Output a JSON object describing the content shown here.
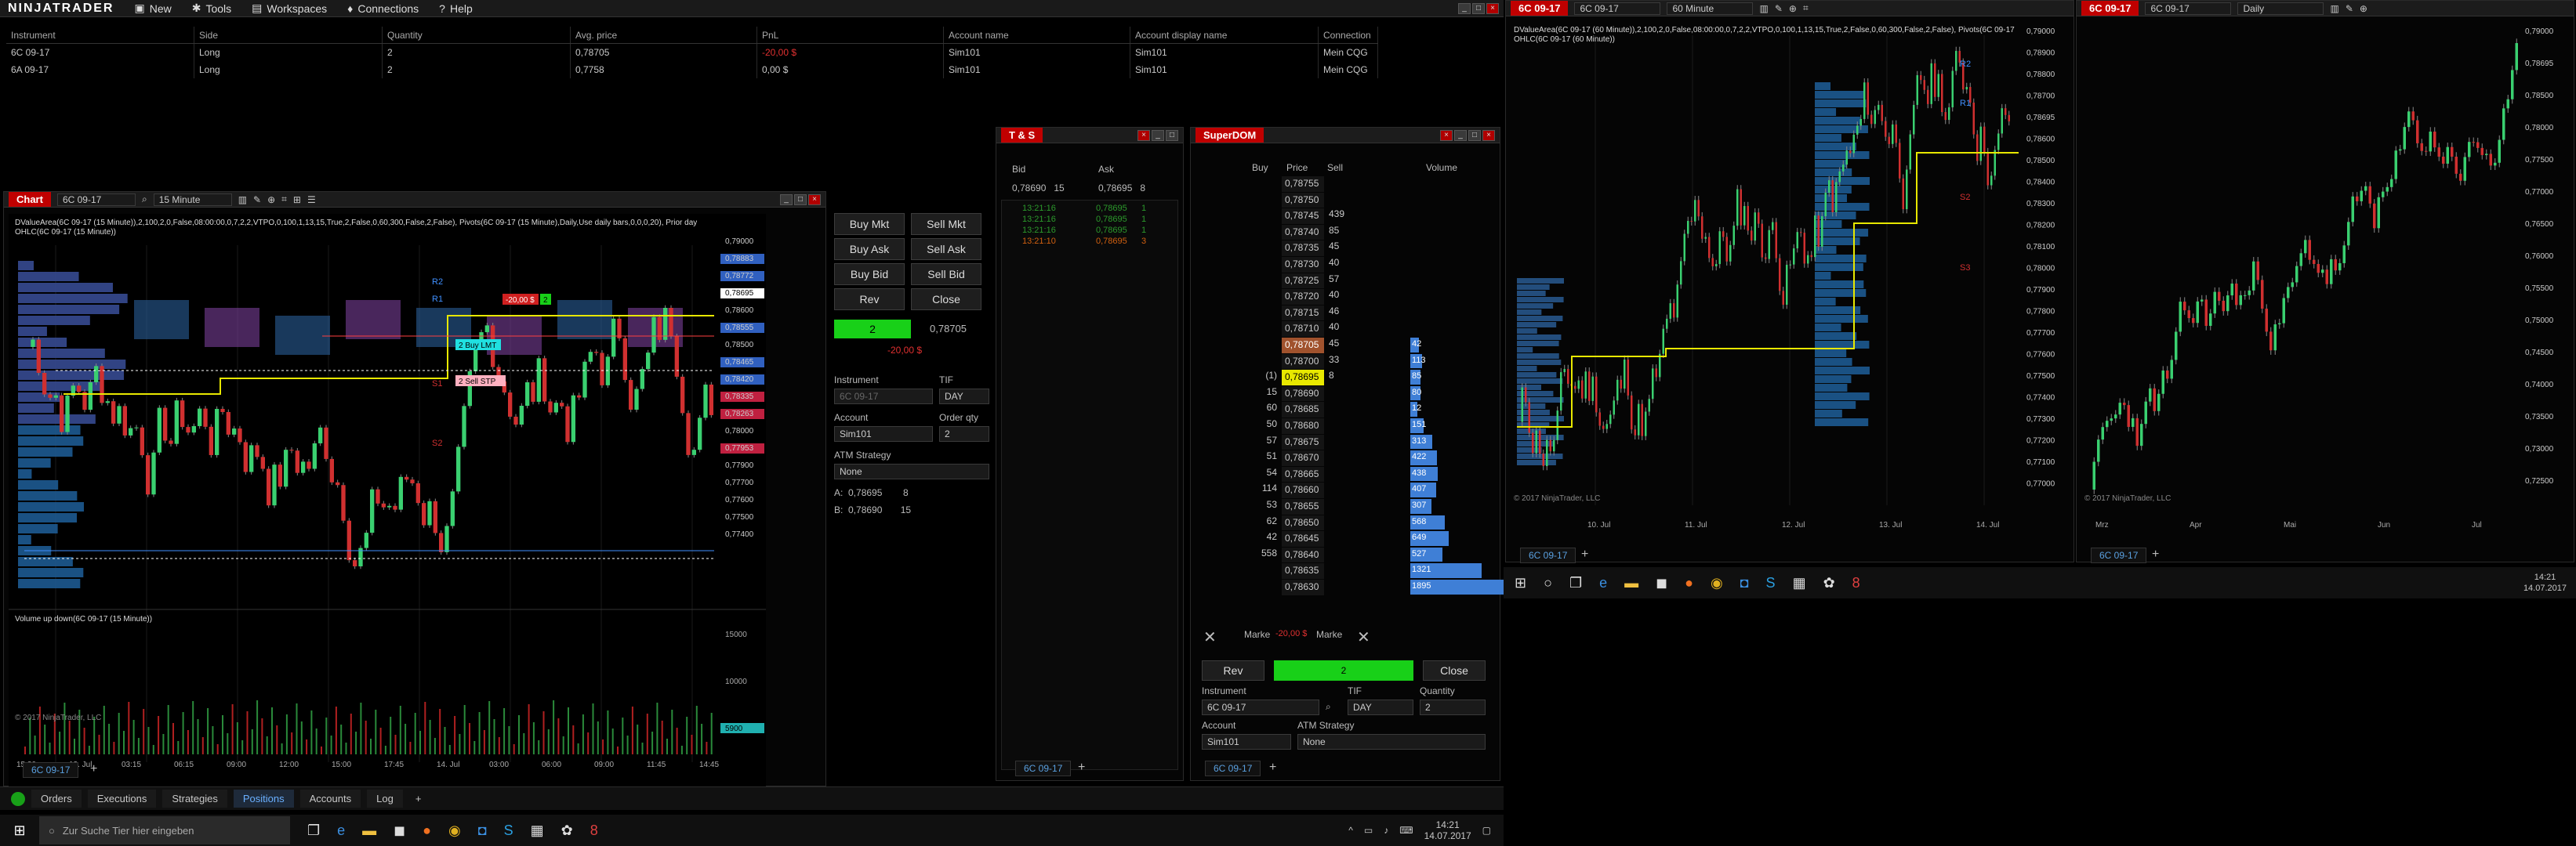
{
  "app": {
    "logo": "NINJATRADER",
    "menu": [
      "New",
      "Tools",
      "Workspaces",
      "Connections",
      "Help"
    ]
  },
  "positions": {
    "headers": [
      "Instrument",
      "Side",
      "Quantity",
      "Avg. price",
      "PnL",
      "Account name",
      "Account display name",
      "Connection"
    ],
    "rows": [
      [
        "6C 09-17",
        "Long",
        "2",
        "0,78705",
        "-20,00 $",
        "Sim101",
        "Sim101",
        "Mein CQG"
      ],
      [
        "6A 09-17",
        "Long",
        "2",
        "0,7758",
        "0,00 $",
        "Sim101",
        "Sim101",
        "Mein CQG"
      ]
    ]
  },
  "chart1": {
    "tab": "Chart",
    "instrument": "6C 09-17",
    "interval": "15 Minute",
    "indicator_line1": "DValueArea(6C 09-17 (15 Minute)),2,100,2,0,False,08:00:00,0,7,2,2,VTPO,0,100,1,13,15,True,2,False,0,60,300,False,2,False), Pivots(6C 09-17 (15 Minute),Daily,Use daily bars,0,0,0,20), Prior day",
    "indicator_line2": "OHLC(6C 09-17 (15 Minute))",
    "price_labels": [
      "0,79000",
      "0,78883",
      "0,78772",
      "0,78695",
      "0,78600",
      "0,78555",
      "0,78500",
      "0,78465",
      "0,78420",
      "0,78335",
      "0,78263",
      "0,78000",
      "0,77953",
      "0,77900",
      "0,77700",
      "0,77600",
      "0,77500",
      "0,77400"
    ],
    "time_labels": [
      "15:30",
      "13. Jul",
      "03:15",
      "06:15",
      "09:00",
      "12:00",
      "15:00",
      "17:45",
      "14. Jul",
      "03:00",
      "06:00",
      "09:00",
      "11:45",
      "14:45"
    ],
    "orders": {
      "buy_lmt": "2  Buy LMT",
      "sell_stp": "2  Sell STP",
      "pnl_flag": "-20,00 $",
      "qty_flag": "2"
    },
    "pivot_labels": [
      "R2",
      "R1",
      "S1",
      "S2"
    ],
    "volume_title": "Volume up down(6C 09-17 (15 Minute))",
    "volume_axis": [
      "15000",
      "10000",
      "5000"
    ],
    "volume_last": "5900",
    "copyright": "© 2017 NinjaTrader, LLC",
    "bottom_tab": "6C 09-17"
  },
  "chart_trader": {
    "buttons": [
      "Buy Mkt",
      "Sell Mkt",
      "Buy Ask",
      "Sell Ask",
      "Buy Bid",
      "Sell Bid",
      "Rev",
      "Close"
    ],
    "position_qty": "2",
    "avg_price": "0,78705",
    "pnl": "-20,00 $",
    "instrument_label": "Instrument",
    "instrument": "6C 09-17",
    "tif_label": "TIF",
    "tif": "DAY",
    "account_label": "Account",
    "account": "Sim101",
    "qty_label": "Order qty",
    "qty": "2",
    "atm_label": "ATM Strategy",
    "atm": "None",
    "ask_line": "A:  0,78695        8",
    "bid_line": "B:  0,78690       15"
  },
  "bottom_tabs": [
    "Orders",
    "Executions",
    "Strategies",
    "Positions",
    "Accounts",
    "Log"
  ],
  "ts": {
    "title": "T & S",
    "bid_h": "Bid",
    "ask_h": "Ask",
    "bid": "0,78690   15",
    "ask": "0,78695   8",
    "rows": [
      [
        "13:21:16",
        "0,78695",
        "1"
      ],
      [
        "13:21:16",
        "0,78695",
        "1"
      ],
      [
        "13:21:16",
        "0,78695",
        "1"
      ],
      [
        "13:21:10",
        "0,78695",
        "3"
      ]
    ],
    "tab": "6C 09-17"
  },
  "dom": {
    "title": "SuperDOM",
    "headers": [
      "Buy",
      "Price",
      "Sell",
      "Volume"
    ],
    "rows": [
      [
        "",
        "0,78755",
        ""
      ],
      [
        "",
        "0,78750",
        ""
      ],
      [
        "",
        "0,78745",
        "439"
      ],
      [
        "",
        "0,78740",
        "85"
      ],
      [
        "",
        "0,78735",
        "45"
      ],
      [
        "",
        "0,78730",
        "40"
      ],
      [
        "",
        "0,78725",
        "57"
      ],
      [
        "",
        "0,78720",
        "40"
      ],
      [
        "",
        "0,78715",
        "46"
      ],
      [
        "",
        "0,78710",
        "40"
      ],
      [
        "",
        "0,78705",
        "45"
      ],
      [
        "",
        "0,78700",
        "33"
      ],
      [
        "(1)",
        "0,78695",
        "8"
      ],
      [
        "15",
        "0,78690",
        ""
      ],
      [
        "60",
        "0,78685",
        ""
      ],
      [
        "50",
        "0,78680",
        ""
      ],
      [
        "57",
        "0,78675",
        ""
      ],
      [
        "51",
        "0,78670",
        ""
      ],
      [
        "54",
        "0,78665",
        ""
      ],
      [
        "114",
        "0,78660",
        ""
      ],
      [
        "53",
        "0,78655",
        ""
      ],
      [
        "62",
        "0,78650",
        ""
      ],
      [
        "42",
        "0,78645",
        ""
      ],
      [
        "558",
        "0,78640",
        ""
      ],
      [
        "",
        "0,78635",
        ""
      ],
      [
        "",
        "0,78630",
        ""
      ]
    ],
    "volume_values": [
      "42",
      "113",
      "85",
      "80",
      "12",
      "151",
      "313",
      "422",
      "438",
      "407",
      "307",
      "568",
      "649",
      "527",
      "1321",
      "1895"
    ],
    "market_row": "Marke",
    "pnl": "-20,00 $",
    "pos": "2",
    "rev": "Rev",
    "close": "Close",
    "instrument_label": "Instrument",
    "instrument": "6C 09-17",
    "tif_label": "TIF",
    "tif": "DAY",
    "qty_label": "Quantity",
    "qty": "2",
    "account_label": "Account",
    "account": "Sim101",
    "atm_label": "ATM Strategy",
    "atm": "None",
    "tab": "6C 09-17"
  },
  "chart2": {
    "tab": "6C 09-17",
    "instrument": "6C 09-17",
    "interval": "60 Minute",
    "indicator_line1": "DValueArea(6C 09-17 (60 Minute)),2,100,2,0,False,08:00:00,0,7,2,2,VTPO,0,100,1,13,15,True,2,False,0,60,300,False,2,False), Pivots(6C 09-17 (60 Minute),Daily,Use daily bars,0,0,0,20), Prior day",
    "indicator_line2": "OHLC(6C 09-17 (60 Minute))",
    "price_labels": [
      "0,79000",
      "0,78900",
      "0,78800",
      "0,78700",
      "0,78695",
      "0,78600",
      "0,78500",
      "0,78400",
      "0,78300",
      "0,78200",
      "0,78100",
      "0,78000",
      "0,77900",
      "0,77800",
      "0,77700",
      "0,77600",
      "0,77500",
      "0,77400",
      "0,77300",
      "0,77200",
      "0,77100",
      "0,77000"
    ],
    "time_labels": [
      "10. Jul",
      "11. Jul",
      "12. Jul",
      "13. Jul",
      "14. Jul"
    ],
    "pivot_labels": [
      "R2",
      "R1",
      "S2",
      "S3"
    ],
    "copyright": "© 2017 NinjaTrader, LLC"
  },
  "chart3": {
    "tab": "6C 09-17",
    "instrument": "6C 09-17",
    "interval": "Daily",
    "price_labels": [
      "0,79000",
      "0,78695",
      "0,78500",
      "0,78000",
      "0,77500",
      "0,77000",
      "0,76500",
      "0,76000",
      "0,75500",
      "0,75000",
      "0,74500",
      "0,74000",
      "0,73500",
      "0,73000",
      "0,72500"
    ],
    "time_labels": [
      "Mrz",
      "Apr",
      "Mai",
      "Jun",
      "Jul"
    ],
    "copyright": "© 2017 NinjaTrader, LLC"
  },
  "taskbar": {
    "search": "Zur Suche Tier hier eingeben",
    "time": "14:21",
    "date": "14.07.2017"
  },
  "colors": {
    "accent": "#c00000",
    "buy_green": "#18d018",
    "sell_red": "#e03030",
    "volume_blue": "#3f7fd6",
    "candle_up": "#44c860",
    "candle_down": "#d03030"
  }
}
